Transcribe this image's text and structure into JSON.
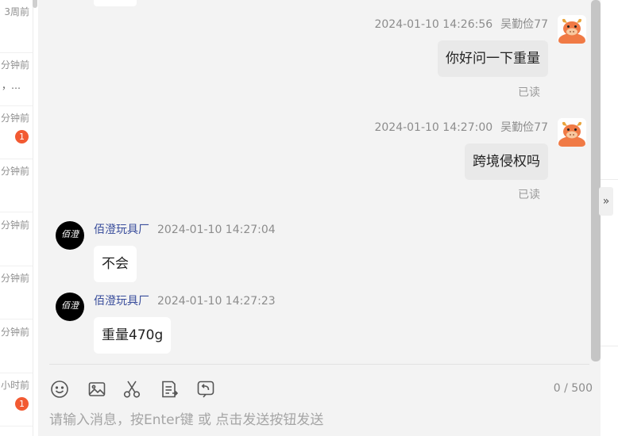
{
  "conversation_list": {
    "items": [
      {
        "time": "3周前",
        "preview": "",
        "badge": ""
      },
      {
        "time": "分钟前",
        "preview": "，…",
        "badge": ""
      },
      {
        "time": "分钟前",
        "preview": "",
        "badge": "1"
      },
      {
        "time": "分钟前",
        "preview": "",
        "badge": ""
      },
      {
        "time": "分钟前",
        "preview": "",
        "badge": ""
      },
      {
        "time": "分钟前",
        "preview": "",
        "badge": ""
      },
      {
        "time": "分钟前",
        "preview": "",
        "badge": ""
      },
      {
        "time": "小时前",
        "preview": "",
        "badge": "1"
      }
    ]
  },
  "messages": [
    {
      "direction": "outgoing",
      "sender": "吴勤俭77",
      "time": "2024-01-10 14:26:56",
      "text": "你好问一下重量",
      "status": "已读"
    },
    {
      "direction": "outgoing",
      "sender": "吴勤俭77",
      "time": "2024-01-10 14:27:00",
      "text": "跨境侵权吗",
      "status": "已读"
    },
    {
      "direction": "incoming",
      "sender": "佰澄玩具厂",
      "time": "2024-01-10 14:27:04",
      "text": "不会"
    },
    {
      "direction": "incoming",
      "sender": "佰澄玩具厂",
      "time": "2024-01-10 14:27:23",
      "text": "重量470g"
    }
  ],
  "avatars": {
    "incoming_brand_text": "佰澄"
  },
  "composer": {
    "char_count": "0 / 500",
    "placeholder": "请输入消息，按Enter键 或 点击发送按钮发送",
    "toolbar": [
      "emoji-icon",
      "image-icon",
      "scissors-icon",
      "order-icon",
      "recall-icon"
    ]
  },
  "right_panel": {
    "expand_glyph": "»"
  },
  "colors": {
    "chat_background": "#f3f3f3",
    "outgoing_bubble": "#e9e9e9",
    "incoming_bubble": "#ffffff",
    "sender_name": "#3a4e9c",
    "badge": "#f25a32",
    "avatar_orange": "#f07a45"
  }
}
